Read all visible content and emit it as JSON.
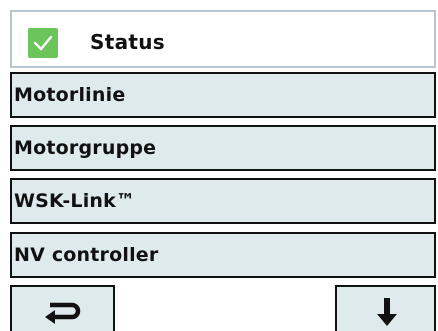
{
  "header": {
    "status_checked": true,
    "title": "Status",
    "check_icon": "checkmark-icon",
    "check_color": "#6cc55b"
  },
  "menu": {
    "items": [
      {
        "label": "Motorlinie"
      },
      {
        "label": "Motorgruppe"
      },
      {
        "label": "WSK-Link™"
      },
      {
        "label": "NV controller"
      }
    ],
    "item_background": "#deeaec"
  },
  "footer": {
    "back_icon": "return-arrow-icon",
    "down_icon": "arrow-down-icon"
  }
}
